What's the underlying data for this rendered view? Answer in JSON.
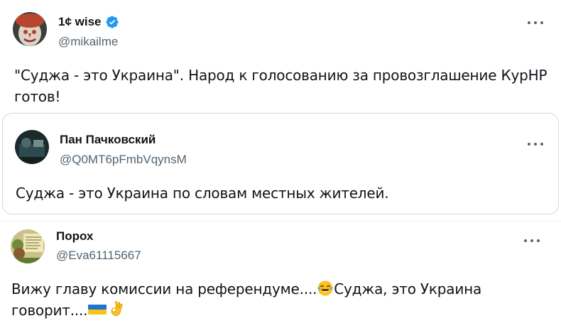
{
  "tweets": [
    {
      "author": {
        "name": "1¢ wise",
        "handle": "@mikailme",
        "verified": true
      },
      "text_line1": "\"Суджа - это Украина\". Народ к голосованию за провозглашение КурНР",
      "text_line2": "готов!",
      "quote": {
        "author": {
          "name": "Пан Пачковский",
          "handle": "@Q0MT6pFmbVqynsM"
        },
        "text": "Суджа - это Украина по словам местных жителей."
      }
    },
    {
      "author": {
        "name": "Порох",
        "handle": "@Eva61115667"
      },
      "text_line1": "Вижу главу комиссии на референдуме....",
      "text_line1_after_emoji": "Суджа, это Украина",
      "text_line2": "говорит....",
      "emojis": [
        "face-with-tears-of-joy-icon",
        "ukraine-flag-icon",
        "ok-hand-icon"
      ]
    }
  ],
  "colors": {
    "verified_badge": "#1d9bf0",
    "handle": "#536471",
    "border": "#cfd9de"
  }
}
